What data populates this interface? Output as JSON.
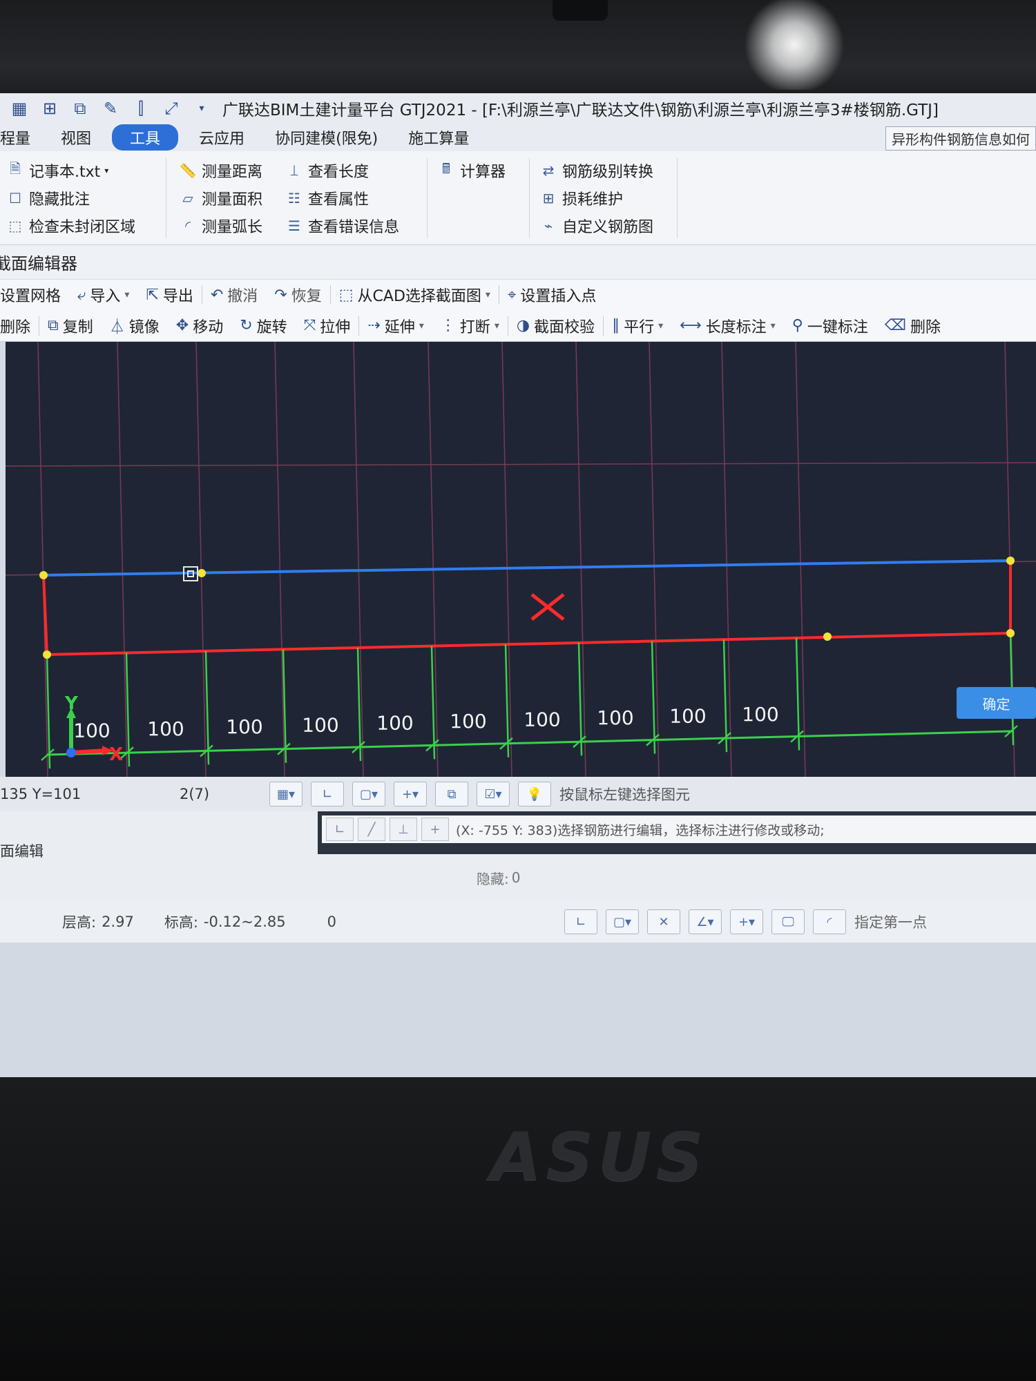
{
  "window": {
    "title": "广联达BIM土建计量平台 GTJ2021 - [F:\\利源兰亭\\广联达文件\\钢筋\\利源兰亭\\利源兰亭3#楼钢筋.GTJ]",
    "quick_icons": [
      "grid-icon",
      "table-icon",
      "layers-icon",
      "pen-icon",
      "bracket-icon",
      "resize-icon"
    ]
  },
  "menu": {
    "items": [
      "程量",
      "视图",
      "工具",
      "云应用",
      "协同建模(限免)",
      "施工算量"
    ],
    "active": "工具",
    "right_tab": "异形构件钢筋信息如何"
  },
  "ribbon": {
    "col1": [
      "记事本.txt",
      "隐藏批注",
      "检查未封闭区域"
    ],
    "col2": [
      "测量距离",
      "测量面积",
      "测量弧长"
    ],
    "col3": [
      "查看长度",
      "查看属性",
      "查看错误信息"
    ],
    "col4": [
      "计算器"
    ],
    "col5": [
      "钢筋级别转换",
      "损耗维护",
      "自定义钢筋图"
    ]
  },
  "editor": {
    "title": "截面编辑器",
    "toolbar1": [
      "设置网格",
      "导入",
      "导出",
      "撤消",
      "恢复",
      "从CAD选择截面图",
      "设置插入点"
    ],
    "toolbar2": [
      "删除",
      "复制",
      "镜像",
      "移动",
      "旋转",
      "拉伸",
      "延伸",
      "打断",
      "截面校验",
      "平行",
      "长度标注",
      "一键标注",
      "删除"
    ]
  },
  "canvas": {
    "dimension_labels": [
      "100",
      "100",
      "100",
      "100",
      "100",
      "100",
      "100",
      "100",
      "100",
      "100"
    ],
    "axis_x": "X",
    "axis_y": "Y",
    "colors": {
      "background": "#1f2535",
      "grid": "#7a3a55",
      "rebar_top": "#2f7df0",
      "rebar_bottom": "#ff2a2a",
      "dimension": "#39d14a",
      "node": "#f2e23a"
    }
  },
  "confirm_label": "确定",
  "status1": {
    "coords": "135 Y=101",
    "count": "2(7)",
    "hint": "按鼠标左键选择图元"
  },
  "command": {
    "text": "(X: -755 Y: 383)选择钢筋进行编辑，选择标注进行修改或移动;",
    "prompt": "指定第一点"
  },
  "lower_left": {
    "label": "面编辑"
  },
  "status2": {
    "floor_height_label": "层高:",
    "floor_height": "2.97",
    "elevation_label": "标高:",
    "elevation": "-0.12~2.85",
    "count": "0",
    "hidden_label": "隐藏:",
    "hidden": "0"
  },
  "bezel_logo": "ASUS"
}
